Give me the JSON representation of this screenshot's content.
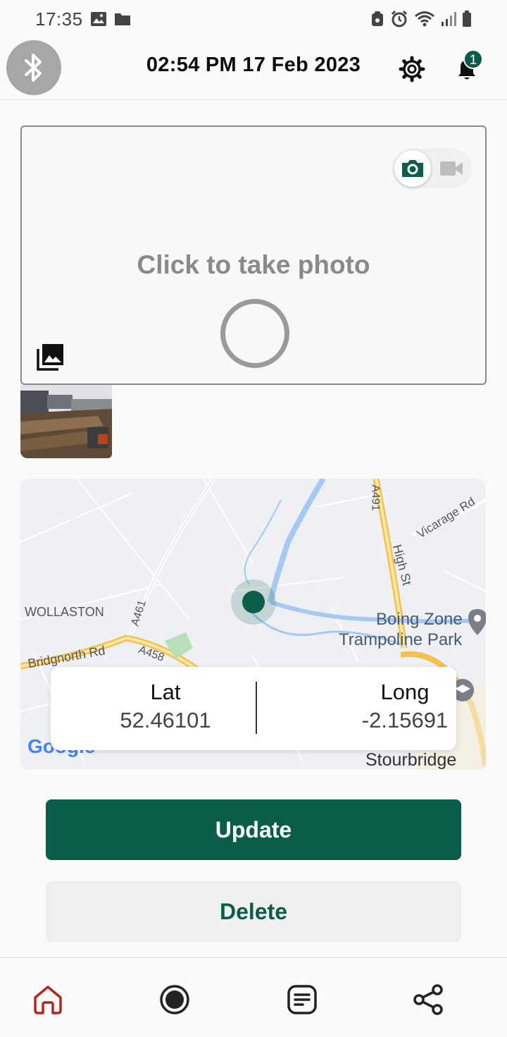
{
  "status_bar": {
    "time": "17:35"
  },
  "header": {
    "datetime": "02:54 PM 17 Feb 2023",
    "notification_count": "1"
  },
  "photo": {
    "prompt": "Click to take photo"
  },
  "map": {
    "labels": {
      "wollaston": "WOLLASTON",
      "a461": "A461",
      "bridgnorth": "Bridgnorth Rd",
      "a458": "A458",
      "a491": "A491",
      "high_st": "High St",
      "vicarage": "Vicarage Rd",
      "poi_line1": "Boing Zone",
      "poi_line2": "Trampoline Park",
      "stourbridge": "Stourbridge",
      "google": "Google"
    },
    "lat_label": "Lat",
    "lat_value": "52.46101",
    "long_label": "Long",
    "long_value": "-2.15691"
  },
  "actions": {
    "update_label": "Update",
    "delete_label": "Delete"
  },
  "colors": {
    "primary": "#0b5d4b",
    "home_active": "#b3261e"
  },
  "icons": [
    "bluetooth-icon",
    "gear-icon",
    "bell-icon",
    "camera-icon",
    "video-icon",
    "gallery-icon",
    "home-icon",
    "record-icon",
    "notes-icon",
    "share-icon"
  ]
}
